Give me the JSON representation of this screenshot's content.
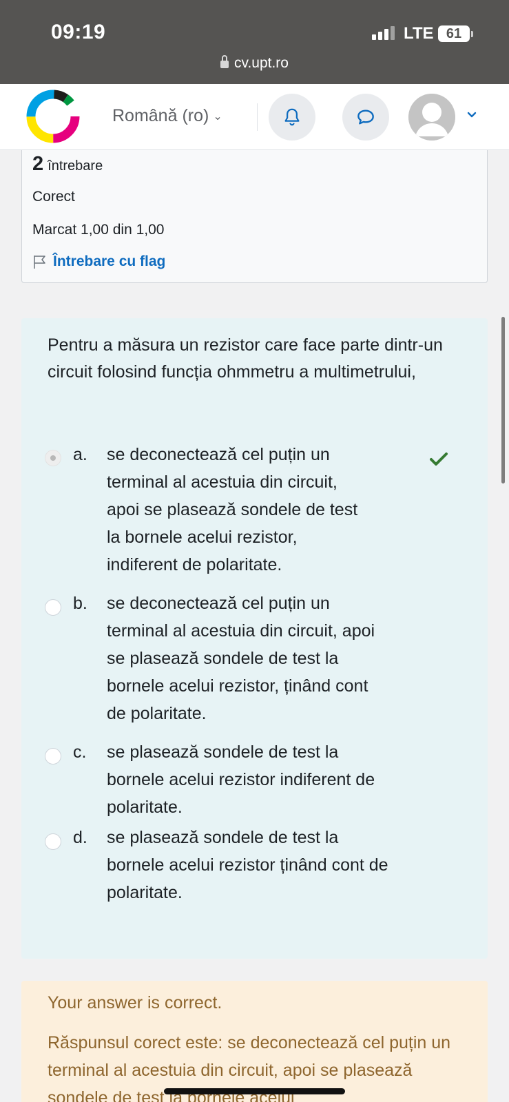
{
  "status_bar": {
    "time": "09:19",
    "network": "LTE",
    "battery": "61",
    "url": "cv.upt.ro"
  },
  "navbar": {
    "language": "Română (ro)",
    "icons": [
      "bell-icon",
      "message-icon",
      "avatar",
      "chevron-down-icon"
    ]
  },
  "question_info": {
    "number": "2",
    "number_label": "întrebare",
    "state": "Corect",
    "grade": "Marcat 1,00 din 1,00",
    "flag_label": "Întrebare cu flag"
  },
  "question": {
    "text": "Pentru a măsura un rezistor care face parte dintr-un circuit folosind funcția ohmmetru a multimetrului,",
    "answers": [
      {
        "letter": "a.",
        "lines": [
          "se deconectează cel puțin un",
          "terminal al acestuia din circuit,",
          "apoi se plasează sondele de test",
          "la bornele acelui rezistor,",
          "indiferent de polaritate."
        ],
        "selected": true,
        "correct": true
      },
      {
        "letter": "b.",
        "lines": [
          "se deconectează cel puțin un",
          "terminal al acestuia din circuit, apoi",
          "se plasează sondele de test la",
          "bornele acelui rezistor, ținând cont",
          "de polaritate."
        ],
        "selected": false,
        "correct": false
      },
      {
        "letter": "c.",
        "lines": [
          "se plasează sondele de test la",
          "bornele acelui rezistor indiferent de",
          "polaritate."
        ],
        "selected": false,
        "correct": false
      },
      {
        "letter": "d.",
        "lines": [
          "se plasează sondele de test la",
          "bornele acelui rezistor ținând cont de",
          "polaritate."
        ],
        "selected": false,
        "correct": false
      }
    ]
  },
  "feedback": {
    "result": "Your answer is correct.",
    "correct_answer": "Răspunsul corect este: se deconectează cel puțin un terminal al acestuia din circuit, apoi se plasează sondele de test la bornele acelui"
  },
  "colors": {
    "status_bar": "#555452",
    "link": "#0f6cbf",
    "content_bg": "#e7f3f5",
    "feedback_bg": "#fcefdc",
    "feedback_text": "#8e662e",
    "tick": "#357a32"
  }
}
